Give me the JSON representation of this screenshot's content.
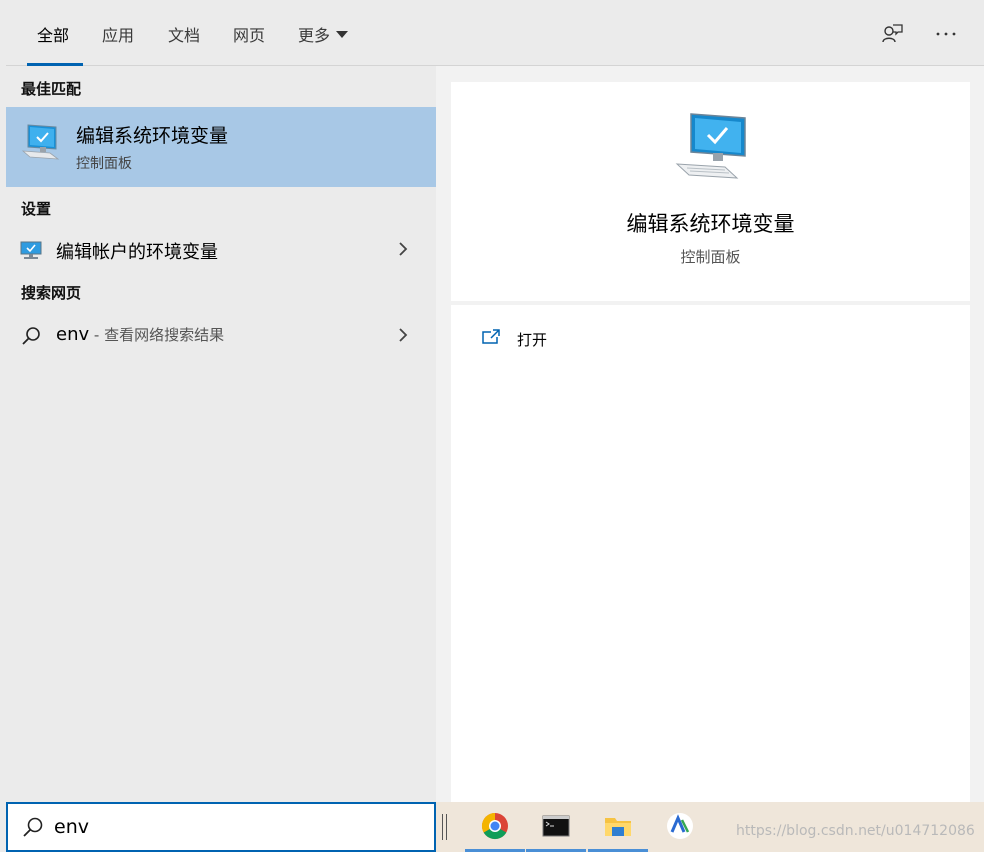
{
  "tabs": [
    {
      "label": "全部",
      "active": true
    },
    {
      "label": "应用"
    },
    {
      "label": "文档"
    },
    {
      "label": "网页"
    },
    {
      "label": "更多"
    }
  ],
  "top_icons": [
    "feedback-icon",
    "more-options-icon"
  ],
  "sections": {
    "best_match": {
      "header": "最佳匹配",
      "title": "编辑系统环境变量",
      "subtitle": "控制面板",
      "icon": "monitor-check-icon"
    },
    "settings": {
      "header": "设置",
      "item": "编辑帐户的环境变量",
      "icon": "settings-monitor-icon"
    },
    "web": {
      "header": "搜索网页",
      "query": "env",
      "suffix": " - 查看网络搜索结果",
      "icon": "search-icon"
    }
  },
  "detail": {
    "title": "编辑系统环境变量",
    "subtitle": "控制面板",
    "actions": [
      {
        "label": "打开",
        "icon": "open-window-icon"
      }
    ]
  },
  "search": {
    "value": "env"
  },
  "taskbar": {
    "apps": [
      "chrome-icon",
      "terminal-icon",
      "file-explorer-icon",
      "app-icon"
    ],
    "watermark": "https://blog.csdn.net/u014712086"
  },
  "colors": {
    "accent": "#0063b1",
    "selection": "#a8c8e6",
    "pane_bg": "#ebebeb"
  }
}
